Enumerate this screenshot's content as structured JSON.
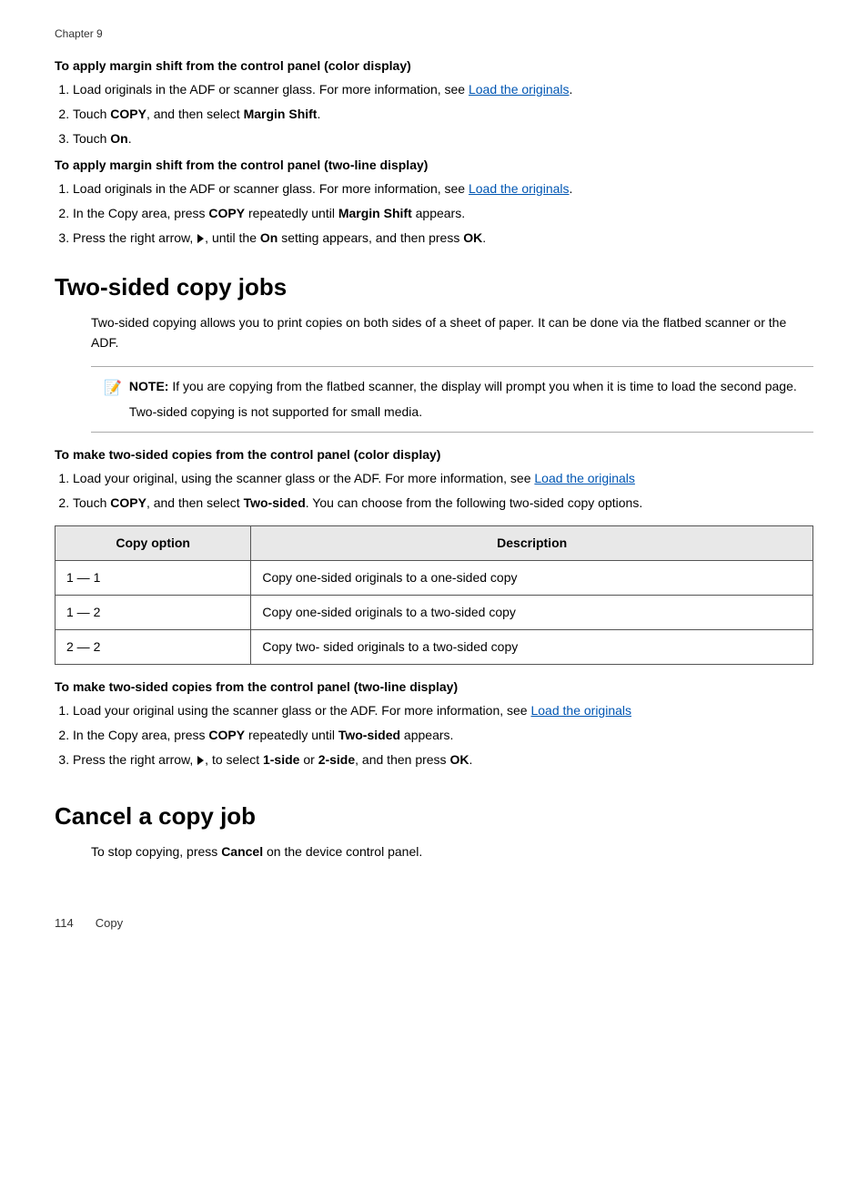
{
  "chapter": {
    "label": "Chapter 9"
  },
  "color_display_section": {
    "heading": "To apply margin shift from the control panel (color display)",
    "steps": [
      {
        "id": 1,
        "text_before": "Load originals in the ADF or scanner glass. For more information, see ",
        "link_text": "Load the originals",
        "text_after": "."
      },
      {
        "id": 2,
        "text": "Touch ",
        "bold1": "COPY",
        "text2": ", and then select ",
        "bold2": "Margin Shift",
        "text3": "."
      },
      {
        "id": 3,
        "text": "Touch ",
        "bold1": "On",
        "text2": "."
      }
    ]
  },
  "two_line_section": {
    "heading": "To apply margin shift from the control panel (two-line display)",
    "steps": [
      {
        "id": 1,
        "text_before": "Load originals in the ADF or scanner glass. For more information, see ",
        "link_text": "Load the originals",
        "text_after": "."
      },
      {
        "id": 2,
        "text": "In the Copy area, press ",
        "bold1": "COPY",
        "text2": " repeatedly until ",
        "bold2": "Margin Shift",
        "text3": " appears."
      },
      {
        "id": 3,
        "text_before": "Press the right arrow, ",
        "arrow": true,
        "text_after": ", until the ",
        "bold1": "On",
        "text2": " setting appears, and then press ",
        "bold2": "OK",
        "text3": "."
      }
    ]
  },
  "two_sided_section": {
    "title": "Two-sided copy jobs",
    "intro": "Two-sided copying allows you to print copies on both sides of a sheet of paper. It can be done via the flatbed scanner or the ADF.",
    "note_label": "NOTE:",
    "note_text1": "  If you are copying from the flatbed scanner, the display will prompt you when it is time to load the second page.",
    "note_text2": "Two-sided copying is not supported for small media.",
    "color_heading": "To make two-sided copies from the control panel (color display)",
    "color_steps": [
      {
        "id": 1,
        "text": "Load your original, using the scanner glass or the ADF. For more information, see ",
        "link_text": "Load the originals",
        "text_after": ""
      },
      {
        "id": 2,
        "text": "Touch ",
        "bold1": "COPY",
        "text2": ", and then select ",
        "bold2": "Two-sided",
        "text3": ". You can choose from the following two-sided copy options."
      }
    ],
    "table": {
      "headers": [
        "Copy option",
        "Description"
      ],
      "rows": [
        [
          "1 — 1",
          "Copy one-sided originals to a one-sided copy"
        ],
        [
          "1 — 2",
          "Copy one-sided originals to a two-sided copy"
        ],
        [
          "2 — 2",
          "Copy two- sided originals to a two-sided copy"
        ]
      ]
    },
    "two_line_heading": "To make two-sided copies from the control panel (two-line display)",
    "two_line_steps": [
      {
        "id": 1,
        "text": "Load your original using the scanner glass or the ADF. For more information, see ",
        "link_text": "Load the originals",
        "text_after": ""
      },
      {
        "id": 2,
        "text": "In the Copy area, press ",
        "bold1": "COPY",
        "text2": " repeatedly until ",
        "bold2": "Two-sided",
        "text3": " appears."
      },
      {
        "id": 3,
        "text_before": "Press the right arrow, ",
        "arrow": true,
        "text2": ", to select ",
        "bold1": "1-side",
        "text3": " or ",
        "bold2": "2-side",
        "text4": ", and then press ",
        "bold3": "OK",
        "text5": "."
      }
    ]
  },
  "cancel_section": {
    "title": "Cancel a copy job",
    "text": "To stop copying, press ",
    "bold": "Cancel",
    "text_after": " on the device control panel."
  },
  "footer": {
    "page_number": "114",
    "section": "Copy"
  }
}
